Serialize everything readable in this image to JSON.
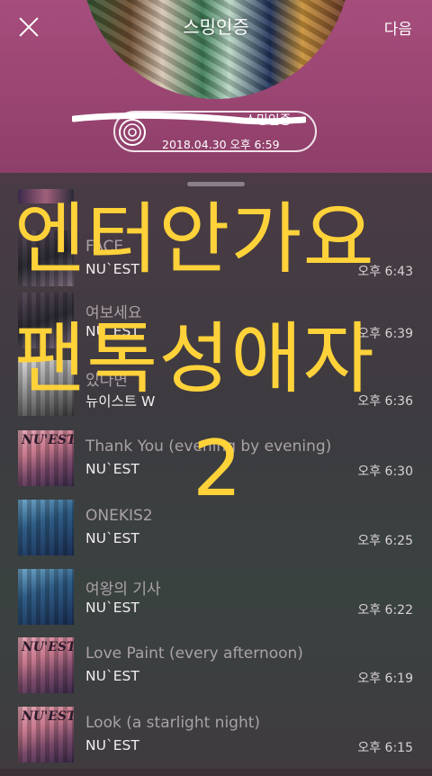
{
  "header": {
    "title": "스밍인증",
    "next_label": "다음",
    "pill_label": "스밍인증",
    "pill_date": "2018.04.30 오후 6:59"
  },
  "tracks": [
    {
      "title": "FACE",
      "artist": "NU`EST",
      "time": "오후 6:43",
      "art": "dark"
    },
    {
      "title": "여보세요",
      "artist": "NU`EST",
      "time": "오후 6:39",
      "art": "dark"
    },
    {
      "title": "있다면",
      "artist": "뉴이스트 W",
      "time": "오후 6:36",
      "art": "gray"
    },
    {
      "title": "Thank You (evening by evening)",
      "artist": "NU`EST",
      "time": "오후 6:30",
      "art": "nuest"
    },
    {
      "title": "ONEKIS2",
      "artist": "NU`EST",
      "time": "오후 6:25",
      "art": "onekis"
    },
    {
      "title": "여왕의 기사",
      "artist": "NU`EST",
      "time": "오후 6:22",
      "art": "onekis"
    },
    {
      "title": "Love Paint (every afternoon)",
      "artist": "NU`EST",
      "time": "오후 6:19",
      "art": "nuest"
    },
    {
      "title": "Look (a starlight night)",
      "artist": "NU`EST",
      "time": "오후 6:15",
      "art": "nuest"
    }
  ],
  "album_logo_text": "NU'EST",
  "overlay": {
    "line1": "엔터안가요",
    "line2": "팬톡성애자",
    "line3": "2"
  },
  "colors": {
    "overlay_text": "#ffd23a",
    "hero_bg": "#9a4572"
  }
}
